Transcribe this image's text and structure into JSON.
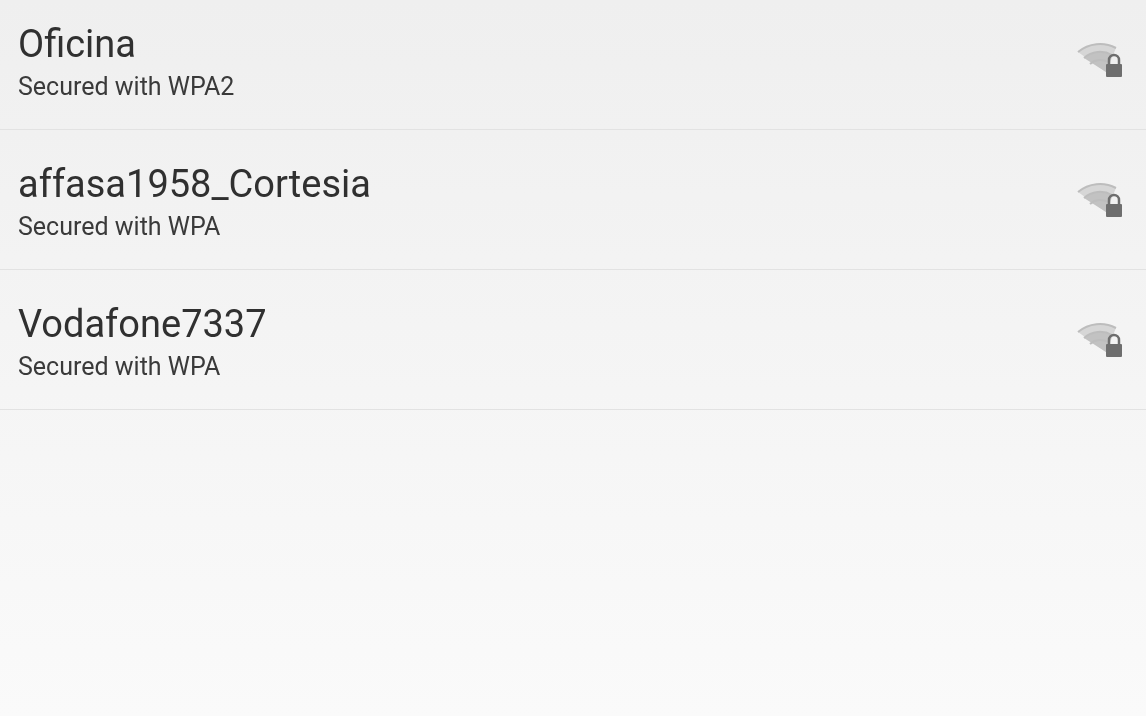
{
  "networks": [
    {
      "name": "Oficina",
      "security": "Secured with WPA2"
    },
    {
      "name": "affasa1958_Cortesia",
      "security": "Secured with WPA"
    },
    {
      "name": "Vodafone7337",
      "security": "Secured with WPA"
    }
  ]
}
